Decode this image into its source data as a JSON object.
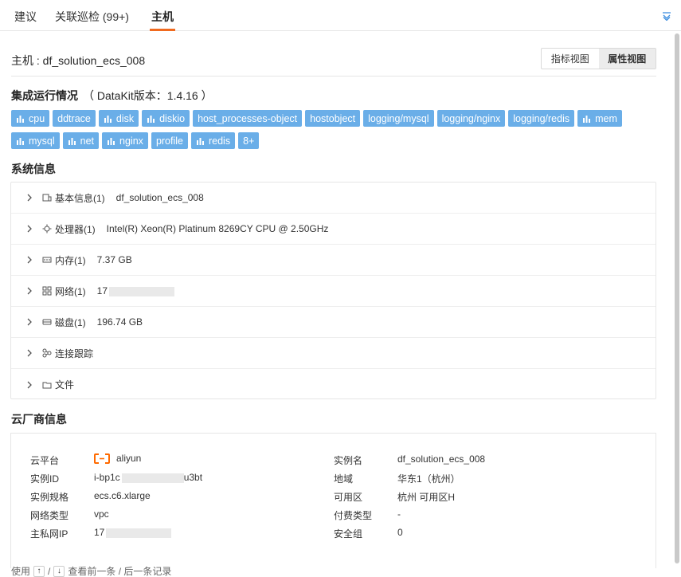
{
  "tabs": [
    {
      "label": "建议",
      "active": false
    },
    {
      "label": "关联巡检 (99+)",
      "active": false
    },
    {
      "label": "主机",
      "active": true
    }
  ],
  "header": {
    "host_title": "主机 : df_solution_ecs_008",
    "view_metrics": "指标视图",
    "view_attributes": "属性视图"
  },
  "integration": {
    "title": "集成运行情况",
    "version": "（ DataKit版本：1.4.16 ）",
    "chips_row1": [
      {
        "label": "cpu",
        "icon": "bar-chart-icon"
      },
      {
        "label": "ddtrace",
        "icon": ""
      },
      {
        "label": "disk",
        "icon": "bar-chart-icon"
      },
      {
        "label": "diskio",
        "icon": "bar-chart-icon"
      },
      {
        "label": "host_processes-object",
        "icon": ""
      },
      {
        "label": "hostobject",
        "icon": ""
      },
      {
        "label": "logging/mysql",
        "icon": ""
      },
      {
        "label": "logging/nginx",
        "icon": ""
      },
      {
        "label": "logging/redis",
        "icon": ""
      },
      {
        "label": "mem",
        "icon": "bar-chart-icon"
      }
    ],
    "chips_row2": [
      {
        "label": "mysql",
        "icon": "bar-chart-icon"
      },
      {
        "label": "net",
        "icon": "bar-chart-icon"
      },
      {
        "label": "nginx",
        "icon": "bar-chart-icon"
      },
      {
        "label": "profile",
        "icon": ""
      },
      {
        "label": "redis",
        "icon": "bar-chart-icon"
      },
      {
        "label": "8+",
        "icon": ""
      }
    ]
  },
  "system": {
    "title": "系统信息",
    "rows": [
      {
        "label": "基本信息(1)",
        "value": "df_solution_ecs_008",
        "icon": "host-icon"
      },
      {
        "label": "处理器(1)",
        "value": "Intel(R) Xeon(R) Platinum 8269CY CPU @ 2.50GHz",
        "icon": "cpu-icon"
      },
      {
        "label": "内存(1)",
        "value": "7.37 GB",
        "icon": "memory-icon"
      },
      {
        "label": "网络(1)",
        "value": "17",
        "icon": "network-icon"
      },
      {
        "label": "磁盘(1)",
        "value": "196.74 GB",
        "icon": "disk-icon"
      },
      {
        "label": "连接跟踪",
        "value": "",
        "icon": "connection-icon"
      },
      {
        "label": "文件",
        "value": "",
        "icon": "folder-icon"
      }
    ]
  },
  "cloud": {
    "title": "云厂商信息",
    "left": [
      {
        "key": "云平台",
        "value": "aliyun"
      },
      {
        "key": "实例ID",
        "value_prefix": "i-bp1c",
        "value_suffix": "u3bt"
      },
      {
        "key": "实例规格",
        "value": "ecs.c6.xlarge"
      },
      {
        "key": "网络类型",
        "value": "vpc"
      },
      {
        "key": "主私网IP",
        "value": "17"
      }
    ],
    "right": [
      {
        "key": "实例名",
        "value": "df_solution_ecs_008"
      },
      {
        "key": "地域",
        "value": "华东1（杭州）"
      },
      {
        "key": "可用区",
        "value": "杭州 可用区H"
      },
      {
        "key": "付费类型",
        "value": "-"
      },
      {
        "key": "安全组",
        "value": "0"
      }
    ]
  },
  "footer": {
    "prefix": "使用",
    "up_key": "↑",
    "sep": "/",
    "down_key": "↓",
    "suffix": "查看前一条 / 后一条记录"
  },
  "colors": {
    "accent": "#f06a1f",
    "chip": "#6aaee8",
    "aliyun": "#ff6a00"
  }
}
